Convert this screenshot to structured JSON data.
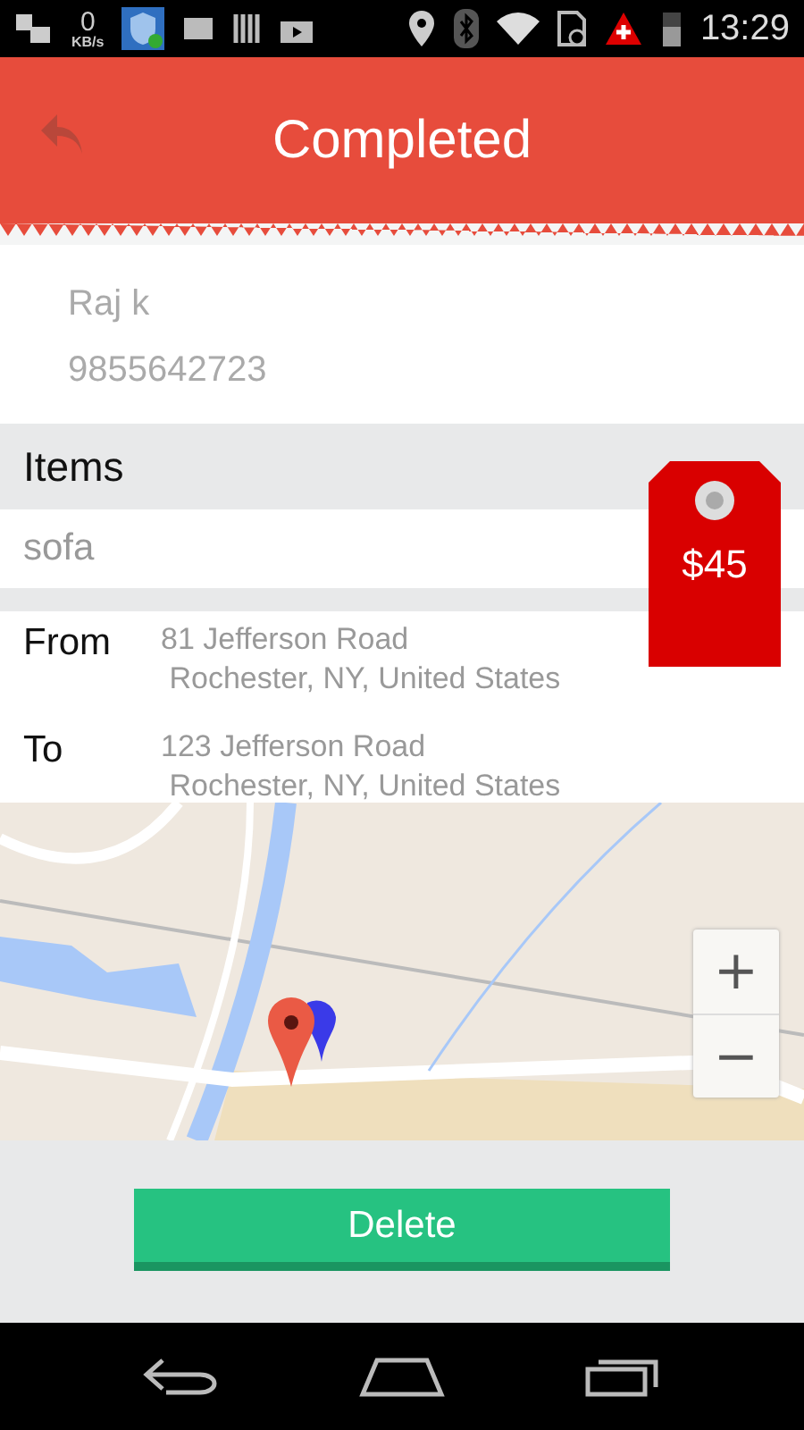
{
  "status_bar": {
    "speed": "0",
    "speed_unit": "KB/s",
    "time": "13:29"
  },
  "header": {
    "title": "Completed"
  },
  "customer": {
    "name": "Raj k",
    "phone": "9855642723"
  },
  "items": {
    "label": "Items",
    "value": "sofa"
  },
  "price": "$45",
  "route": [
    {
      "label": "From",
      "line1": "81 Jefferson Road",
      "line2": " Rochester, NY, United States"
    },
    {
      "label": "To",
      "line1": "123 Jefferson Road",
      "line2": " Rochester, NY, United States"
    }
  ],
  "map": {
    "kind": "picture",
    "zoom_in": "+",
    "zoom_out": "−"
  },
  "delete_button": "Delete"
}
